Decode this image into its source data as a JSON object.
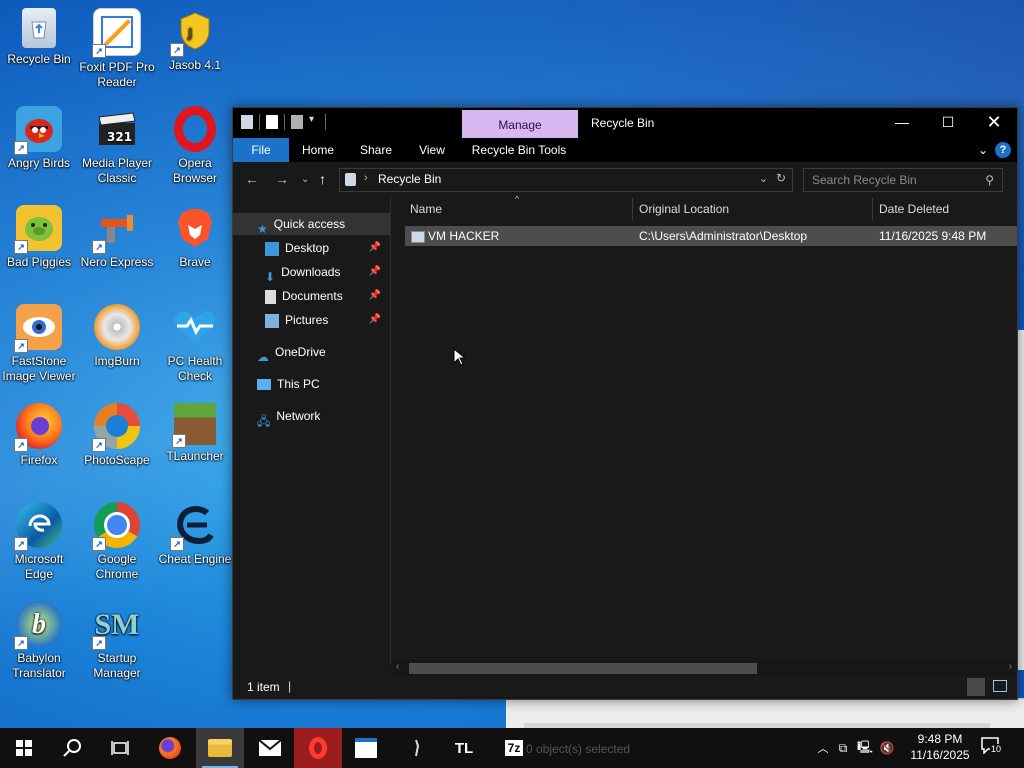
{
  "desktop": {
    "icons": [
      {
        "label": "Recycle Bin"
      },
      {
        "label": "Foxit PDF Pro Reader"
      },
      {
        "label": "Jasob 4.1"
      },
      {
        "label": "Angry Birds"
      },
      {
        "label": "Media Player Classic"
      },
      {
        "label": "Opera Browser"
      },
      {
        "label": "Bad Piggies"
      },
      {
        "label": "Nero Express"
      },
      {
        "label": "Brave"
      },
      {
        "label": "FastStone Image Viewer"
      },
      {
        "label": "ImgBurn"
      },
      {
        "label": "PC Health Check"
      },
      {
        "label": "Firefox"
      },
      {
        "label": "PhotoScape"
      },
      {
        "label": "TLauncher"
      },
      {
        "label": "Microsoft Edge"
      },
      {
        "label": "Google Chrome"
      },
      {
        "label": "Cheat Engine"
      },
      {
        "label": "Babylon Translator"
      },
      {
        "label": "Startup Manager"
      }
    ]
  },
  "explorer": {
    "title": "Recycle Bin",
    "manage_tab": "Manage",
    "ribbon_tabs": [
      "File",
      "Home",
      "Share",
      "View",
      "Recycle Bin Tools"
    ],
    "address": "Recycle Bin",
    "search_placeholder": "Search Recycle Bin",
    "nav": {
      "quick_access": "Quick access",
      "desktop": "Desktop",
      "downloads": "Downloads",
      "documents": "Documents",
      "pictures": "Pictures",
      "onedrive": "OneDrive",
      "this_pc": "This PC",
      "network": "Network"
    },
    "columns": {
      "name": "Name",
      "original_location": "Original Location",
      "date_deleted": "Date Deleted"
    },
    "rows": [
      {
        "name": "VM HACKER",
        "location": "C:\\Users\\Administrator\\Desktop",
        "date": "11/16/2025 9:48 PM"
      }
    ],
    "status": "1 item"
  },
  "background_window": {
    "status_text": "0 object(s) selected"
  },
  "taskbar": {
    "clock_time": "9:48 PM",
    "clock_date": "11/16/2025",
    "notification_count": "10",
    "tlauncher_label": "TL",
    "sevenzip_label": "7z"
  },
  "colors": {
    "accent": "#1a73c8",
    "manage_tab": "#d7b8f0",
    "window_bg": "#191919",
    "taskbar_bg": "#101010"
  }
}
